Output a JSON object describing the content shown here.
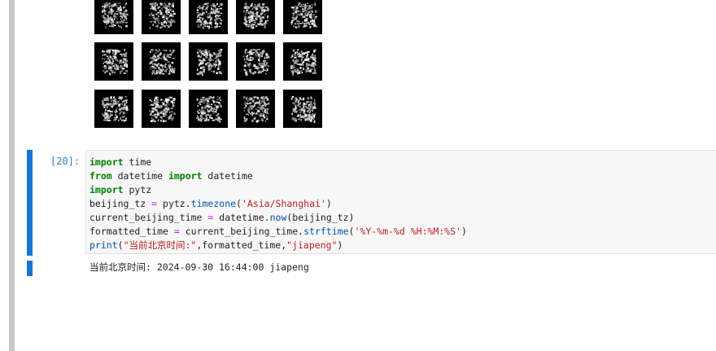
{
  "notebook": {
    "output_images": {
      "rows": 3,
      "cols": 5,
      "description_icons": [
        "generated-digit-image"
      ]
    },
    "cell": {
      "prompt": "[20]:",
      "code_lines": [
        [
          {
            "t": "kw",
            "v": "import"
          },
          {
            "t": "p",
            "v": " time"
          }
        ],
        [
          {
            "t": "kw",
            "v": "from"
          },
          {
            "t": "p",
            "v": " datetime "
          },
          {
            "t": "kw",
            "v": "import"
          },
          {
            "t": "p",
            "v": " datetime"
          }
        ],
        [
          {
            "t": "kw",
            "v": "import"
          },
          {
            "t": "p",
            "v": " pytz"
          }
        ],
        [
          {
            "t": "p",
            "v": "beijing_tz "
          },
          {
            "t": "op",
            "v": "="
          },
          {
            "t": "p",
            "v": " pytz."
          },
          {
            "t": "fn",
            "v": "timezone"
          },
          {
            "t": "p",
            "v": "("
          },
          {
            "t": "str",
            "v": "'Asia/Shanghai'"
          },
          {
            "t": "p",
            "v": ")"
          }
        ],
        [
          {
            "t": "p",
            "v": "current_beijing_time "
          },
          {
            "t": "op",
            "v": "="
          },
          {
            "t": "p",
            "v": " datetime."
          },
          {
            "t": "fn",
            "v": "now"
          },
          {
            "t": "p",
            "v": "(beijing_tz)"
          }
        ],
        [
          {
            "t": "p",
            "v": "formatted_time "
          },
          {
            "t": "op",
            "v": "="
          },
          {
            "t": "p",
            "v": " current_beijing_time."
          },
          {
            "t": "fn",
            "v": "strftime"
          },
          {
            "t": "p",
            "v": "("
          },
          {
            "t": "str",
            "v": "'%Y-%m-%d %H:%M:%S'"
          },
          {
            "t": "p",
            "v": ")"
          }
        ],
        [
          {
            "t": "fn",
            "v": "print"
          },
          {
            "t": "p",
            "v": "("
          },
          {
            "t": "str",
            "v": "\"当前北京时间:\""
          },
          {
            "t": "p",
            "v": ",formatted_time,"
          },
          {
            "t": "str",
            "v": "\"jiapeng\""
          },
          {
            "t": "p",
            "v": ")"
          }
        ]
      ],
      "output": "当前北京时间: 2024-09-30 16:44:00 jiapeng"
    },
    "colors": {
      "keyword": "#008000",
      "function": "#0055aa",
      "string": "#ba2121",
      "active_cell": "#1976d2"
    }
  }
}
